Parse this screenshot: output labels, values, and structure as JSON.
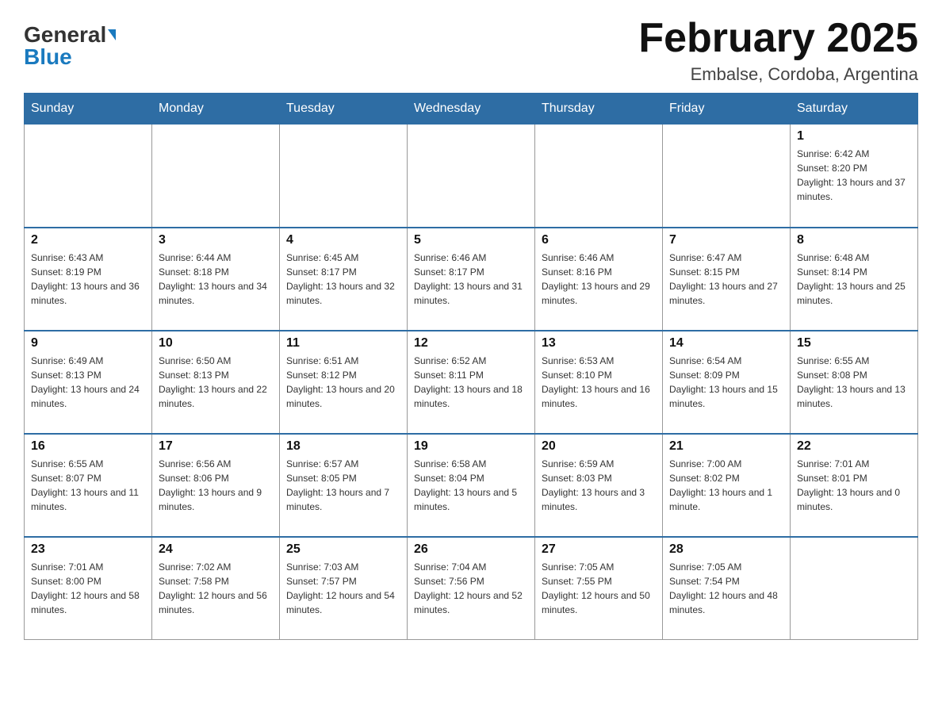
{
  "header": {
    "logo_general": "General",
    "logo_blue": "Blue",
    "month_title": "February 2025",
    "location": "Embalse, Cordoba, Argentina"
  },
  "weekdays": [
    "Sunday",
    "Monday",
    "Tuesday",
    "Wednesday",
    "Thursday",
    "Friday",
    "Saturday"
  ],
  "weeks": [
    [
      {
        "day": "",
        "info": ""
      },
      {
        "day": "",
        "info": ""
      },
      {
        "day": "",
        "info": ""
      },
      {
        "day": "",
        "info": ""
      },
      {
        "day": "",
        "info": ""
      },
      {
        "day": "",
        "info": ""
      },
      {
        "day": "1",
        "info": "Sunrise: 6:42 AM\nSunset: 8:20 PM\nDaylight: 13 hours and 37 minutes."
      }
    ],
    [
      {
        "day": "2",
        "info": "Sunrise: 6:43 AM\nSunset: 8:19 PM\nDaylight: 13 hours and 36 minutes."
      },
      {
        "day": "3",
        "info": "Sunrise: 6:44 AM\nSunset: 8:18 PM\nDaylight: 13 hours and 34 minutes."
      },
      {
        "day": "4",
        "info": "Sunrise: 6:45 AM\nSunset: 8:17 PM\nDaylight: 13 hours and 32 minutes."
      },
      {
        "day": "5",
        "info": "Sunrise: 6:46 AM\nSunset: 8:17 PM\nDaylight: 13 hours and 31 minutes."
      },
      {
        "day": "6",
        "info": "Sunrise: 6:46 AM\nSunset: 8:16 PM\nDaylight: 13 hours and 29 minutes."
      },
      {
        "day": "7",
        "info": "Sunrise: 6:47 AM\nSunset: 8:15 PM\nDaylight: 13 hours and 27 minutes."
      },
      {
        "day": "8",
        "info": "Sunrise: 6:48 AM\nSunset: 8:14 PM\nDaylight: 13 hours and 25 minutes."
      }
    ],
    [
      {
        "day": "9",
        "info": "Sunrise: 6:49 AM\nSunset: 8:13 PM\nDaylight: 13 hours and 24 minutes."
      },
      {
        "day": "10",
        "info": "Sunrise: 6:50 AM\nSunset: 8:13 PM\nDaylight: 13 hours and 22 minutes."
      },
      {
        "day": "11",
        "info": "Sunrise: 6:51 AM\nSunset: 8:12 PM\nDaylight: 13 hours and 20 minutes."
      },
      {
        "day": "12",
        "info": "Sunrise: 6:52 AM\nSunset: 8:11 PM\nDaylight: 13 hours and 18 minutes."
      },
      {
        "day": "13",
        "info": "Sunrise: 6:53 AM\nSunset: 8:10 PM\nDaylight: 13 hours and 16 minutes."
      },
      {
        "day": "14",
        "info": "Sunrise: 6:54 AM\nSunset: 8:09 PM\nDaylight: 13 hours and 15 minutes."
      },
      {
        "day": "15",
        "info": "Sunrise: 6:55 AM\nSunset: 8:08 PM\nDaylight: 13 hours and 13 minutes."
      }
    ],
    [
      {
        "day": "16",
        "info": "Sunrise: 6:55 AM\nSunset: 8:07 PM\nDaylight: 13 hours and 11 minutes."
      },
      {
        "day": "17",
        "info": "Sunrise: 6:56 AM\nSunset: 8:06 PM\nDaylight: 13 hours and 9 minutes."
      },
      {
        "day": "18",
        "info": "Sunrise: 6:57 AM\nSunset: 8:05 PM\nDaylight: 13 hours and 7 minutes."
      },
      {
        "day": "19",
        "info": "Sunrise: 6:58 AM\nSunset: 8:04 PM\nDaylight: 13 hours and 5 minutes."
      },
      {
        "day": "20",
        "info": "Sunrise: 6:59 AM\nSunset: 8:03 PM\nDaylight: 13 hours and 3 minutes."
      },
      {
        "day": "21",
        "info": "Sunrise: 7:00 AM\nSunset: 8:02 PM\nDaylight: 13 hours and 1 minute."
      },
      {
        "day": "22",
        "info": "Sunrise: 7:01 AM\nSunset: 8:01 PM\nDaylight: 13 hours and 0 minutes."
      }
    ],
    [
      {
        "day": "23",
        "info": "Sunrise: 7:01 AM\nSunset: 8:00 PM\nDaylight: 12 hours and 58 minutes."
      },
      {
        "day": "24",
        "info": "Sunrise: 7:02 AM\nSunset: 7:58 PM\nDaylight: 12 hours and 56 minutes."
      },
      {
        "day": "25",
        "info": "Sunrise: 7:03 AM\nSunset: 7:57 PM\nDaylight: 12 hours and 54 minutes."
      },
      {
        "day": "26",
        "info": "Sunrise: 7:04 AM\nSunset: 7:56 PM\nDaylight: 12 hours and 52 minutes."
      },
      {
        "day": "27",
        "info": "Sunrise: 7:05 AM\nSunset: 7:55 PM\nDaylight: 12 hours and 50 minutes."
      },
      {
        "day": "28",
        "info": "Sunrise: 7:05 AM\nSunset: 7:54 PM\nDaylight: 12 hours and 48 minutes."
      },
      {
        "day": "",
        "info": ""
      }
    ]
  ]
}
